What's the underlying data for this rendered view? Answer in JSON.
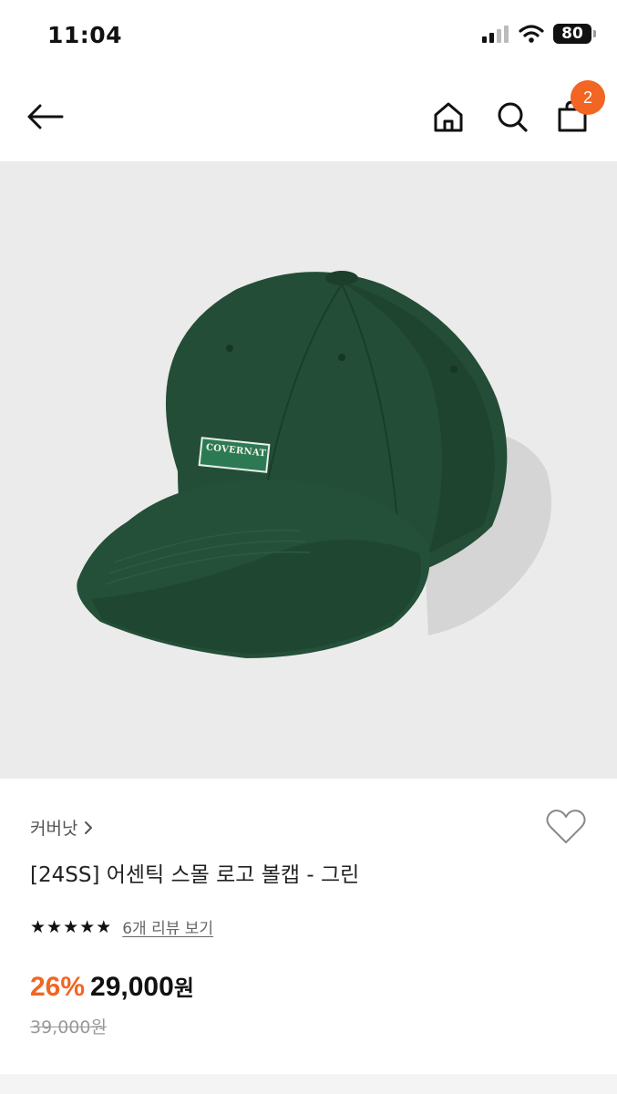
{
  "status": {
    "time": "11:04",
    "battery": "80"
  },
  "nav": {
    "cart_count": "2"
  },
  "product": {
    "brand": "커버낫",
    "name": "[24SS] 어센틱 스몰 로고 볼캡 - 그린",
    "logo_text": "COVERNAT",
    "rating_stars": 5,
    "review_link": "6개 리뷰 보기",
    "discount": "26%",
    "price": "29,000",
    "price_unit": "원",
    "original_price": "39,000원"
  },
  "colors": {
    "accent": "#f26522",
    "cap_green": "#1f4a33"
  },
  "icons": [
    "back-arrow-icon",
    "home-icon",
    "search-icon",
    "shopping-bag-icon",
    "heart-icon",
    "chevron-right-icon",
    "star-icon"
  ]
}
